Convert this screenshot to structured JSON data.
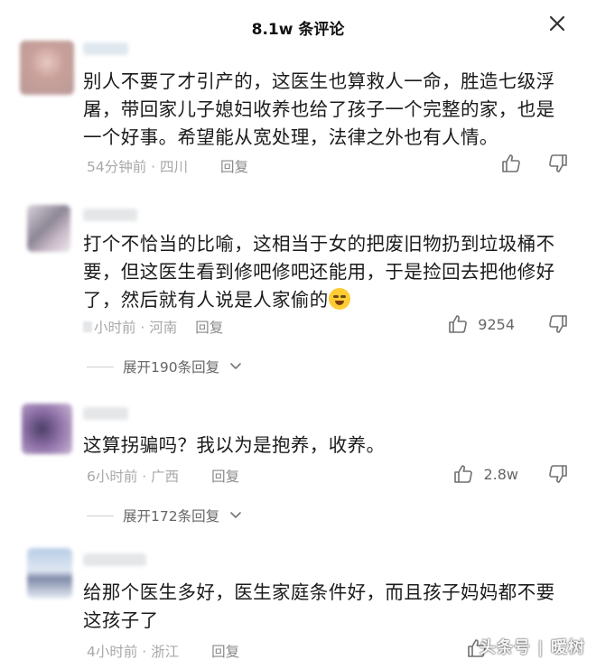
{
  "header": {
    "title": "8.1w 条评论",
    "close_icon": "close-icon"
  },
  "comments": [
    {
      "text": "别人不要了才引产的，这医生也算救人一命，胜造七级浮屠，带回家儿子媳妇收养也给了孩子一个完整的家，也是一个好事。希望能从宽处理，法律之外也有人情。",
      "meta": "54分钟前 · 四川",
      "reply": "回复",
      "likes": ""
    },
    {
      "text": "打个不恰当的比喻，这相当于女的把废旧物扔到垃圾桶不要，但这医生看到修吧修吧还能用，于是捡回去把他修好了，然后就有人说是人家偷的",
      "meta": "小时前 · 河南",
      "reply": "回复",
      "likes": "9254",
      "expand": "展开190条回复"
    },
    {
      "text": "这算拐骗吗？我以为是抱养，收养。",
      "meta": "6小时前 · 广西",
      "reply": "回复",
      "likes": "2.8w",
      "expand": "展开172条回复"
    },
    {
      "text": "给那个医生多好，医生家庭条件好，而且孩子妈妈都不要这孩子了",
      "meta": "4小时前 · 浙江",
      "reply": "回复",
      "likes": ""
    }
  ],
  "watermark": "头条号 | 暖树",
  "colors": {
    "meta": "#a8a8a8",
    "text": "#1b1b1b",
    "icon": "#707070"
  }
}
